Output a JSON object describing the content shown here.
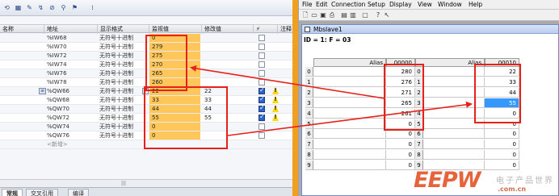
{
  "left": {
    "columns": [
      "名称",
      "地址",
      "显示格式",
      "监视值",
      "修改值",
      "注释"
    ],
    "rows": [
      {
        "address": "%IW68",
        "format": "无符号十进制",
        "monitor": "0",
        "modify": "",
        "checked": false,
        "warn": false
      },
      {
        "address": "%IW70",
        "format": "无符号十进制",
        "monitor": "279",
        "modify": "",
        "checked": false,
        "warn": false
      },
      {
        "address": "%IW72",
        "format": "无符号十进制",
        "monitor": "275",
        "modify": "",
        "checked": false,
        "warn": false
      },
      {
        "address": "%IW74",
        "format": "无符号十进制",
        "monitor": "270",
        "modify": "",
        "checked": false,
        "warn": false
      },
      {
        "address": "%IW76",
        "format": "无符号十进制",
        "monitor": "265",
        "modify": "",
        "checked": false,
        "warn": false
      },
      {
        "address": "%IW78",
        "format": "无符号十进制",
        "monitor": "260",
        "modify": "",
        "checked": false,
        "warn": false
      },
      {
        "address": "%QW66",
        "format": "无符号十进制",
        "monitor": "22",
        "modify": "22",
        "checked": true,
        "warn": true
      },
      {
        "address": "%QW68",
        "format": "无符号十进制",
        "monitor": "33",
        "modify": "33",
        "checked": true,
        "warn": true
      },
      {
        "address": "%QW70",
        "format": "无符号十进制",
        "monitor": "44",
        "modify": "44",
        "checked": true,
        "warn": true
      },
      {
        "address": "%QW72",
        "format": "无符号十进制",
        "monitor": "55",
        "modify": "55",
        "checked": true,
        "warn": true
      },
      {
        "address": "%QW74",
        "format": "无符号十进制",
        "monitor": "0",
        "modify": "",
        "checked": false,
        "warn": false
      },
      {
        "address": "%QW76",
        "format": "无符号十进制",
        "monitor": "0",
        "modify": "",
        "checked": false,
        "warn": false
      },
      {
        "address": "<新增>",
        "format": "",
        "monitor": "",
        "modify": "",
        "checked": false,
        "warn": false
      }
    ],
    "tabs": [
      "常规",
      "交叉引用",
      "编译"
    ]
  },
  "right": {
    "menu": [
      "File",
      "Edit",
      "Connection",
      "Setup",
      "Display",
      "View",
      "Window",
      "Help"
    ],
    "window_title": "Mbslave1",
    "id_line": "ID = 1: F = 03",
    "col_headers": [
      "Alias",
      "00000",
      "Alias",
      "00010"
    ],
    "col1": [
      "280",
      "276",
      "271",
      "265",
      "261",
      "0",
      "0",
      "0",
      "0",
      "0"
    ],
    "col2": [
      "22",
      "33",
      "44",
      "55",
      "0",
      "0",
      "0",
      "0",
      "0",
      "0"
    ],
    "selected": {
      "column": 2,
      "row": 3
    }
  },
  "watermark": {
    "brand": "EEPW",
    "sub": "电子产品世界",
    "url": ".com.cn"
  },
  "colors": {
    "monitor_bg": "#ffc65a",
    "annotation": "#e8201a",
    "selection": "#3399ff",
    "accent": "#f0a020"
  }
}
